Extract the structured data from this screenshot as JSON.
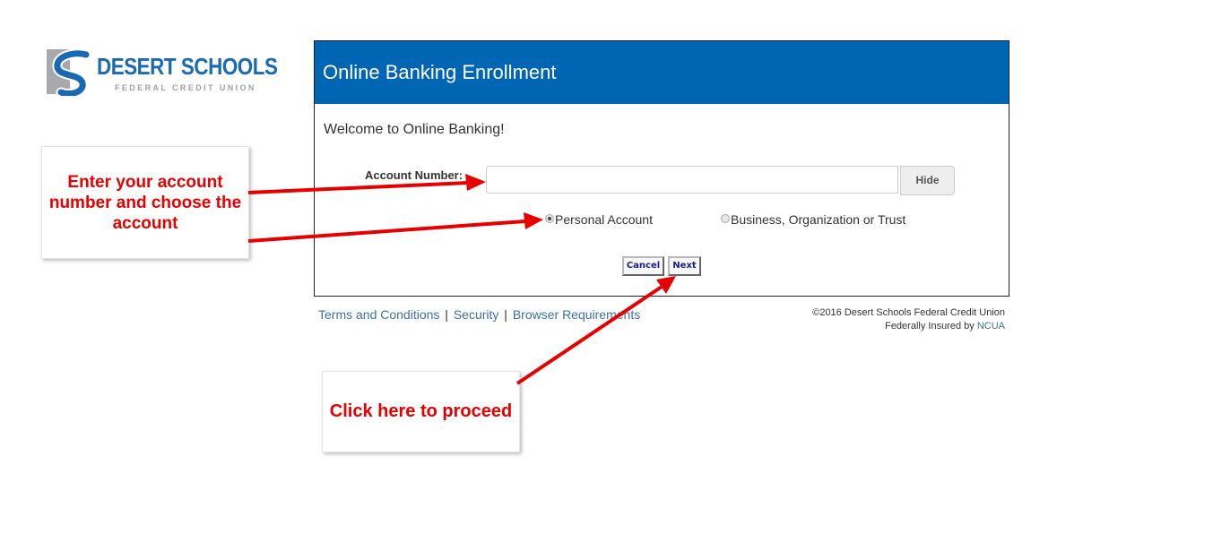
{
  "logo": {
    "name": "DESERT SCHOOLS",
    "subtitle": "FEDERAL CREDIT UNION",
    "mark_colors": {
      "blue": "#1a6ab3",
      "gray": "#a7a9ac"
    }
  },
  "panel": {
    "title": "Online Banking Enrollment",
    "header_color": "#0066b3",
    "welcome": "Welcome to Online Banking!",
    "account_label": "Account Number:",
    "account_value": "",
    "hide_label": "Hide",
    "radios": [
      {
        "label": "Personal Account",
        "checked": true
      },
      {
        "label": "Business, Organization or Trust",
        "checked": false
      }
    ],
    "cancel_label": "Cancel",
    "next_label": "Next"
  },
  "footer": {
    "links": [
      "Terms and Conditions",
      "Security",
      "Browser Requirements"
    ],
    "separator": "|",
    "copyright": "©2016 Desert Schools Federal Credit Union",
    "insured_prefix": "Federally Insured by",
    "insured_link": "NCUA"
  },
  "annotations": {
    "account_callout": "Enter your account number and choose the account",
    "next_callout": "Click here to proceed",
    "arrow_color": "#e60000"
  }
}
